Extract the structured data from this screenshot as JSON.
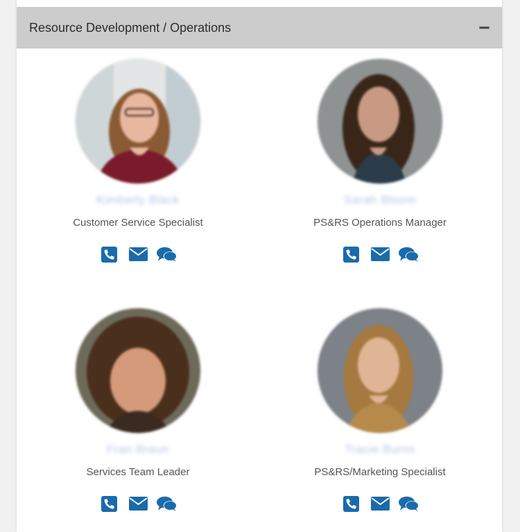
{
  "section": {
    "title": "Resource Development / Operations"
  },
  "colors": {
    "icon": "#1a6bab",
    "header_bg": "#cccccc"
  },
  "people": [
    {
      "name": "Kimberly Black",
      "role": "Customer Service Specialist"
    },
    {
      "name": "Sarah Bloom",
      "role": "PS&RS Operations Manager"
    },
    {
      "name": "Fran Braun",
      "role": "Services Team Leader"
    },
    {
      "name": "Tracie Burns",
      "role": "PS&RS/Marketing Specialist"
    }
  ],
  "icons": [
    "phone-icon",
    "envelope-icon",
    "chat-icon"
  ]
}
